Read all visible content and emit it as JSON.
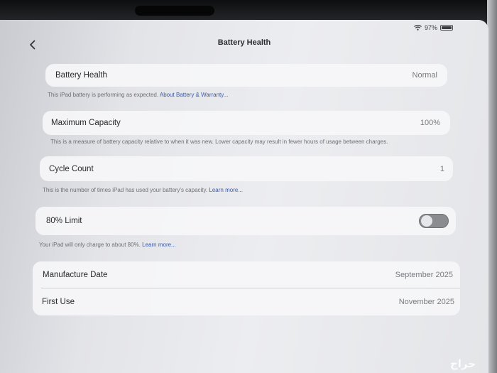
{
  "status": {
    "battery_text": "97%",
    "battery_level": 0.97
  },
  "header": {
    "title": "Battery Health"
  },
  "battery_health": {
    "label": "Battery Health",
    "value": "Normal",
    "note": "This iPad battery is performing as expected.",
    "link": "About Battery & Warranty..."
  },
  "max_capacity": {
    "label": "Maximum Capacity",
    "value": "100%",
    "note": "This is a measure of battery capacity relative to when it was new. Lower capacity may result in fewer hours of usage between charges."
  },
  "cycle_count": {
    "label": "Cycle Count",
    "value": "1",
    "note": "This is the number of times iPad has used your battery's capacity.",
    "link": "Learn more..."
  },
  "limit_80": {
    "label": "80% Limit",
    "enabled": false,
    "note": "Your iPad will only charge to about 80%.",
    "link": "Learn more..."
  },
  "dates": {
    "manufacture_label": "Manufacture Date",
    "manufacture_value": "September 2025",
    "first_use_label": "First Use",
    "first_use_value": "November 2025"
  },
  "watermark": "حراج"
}
